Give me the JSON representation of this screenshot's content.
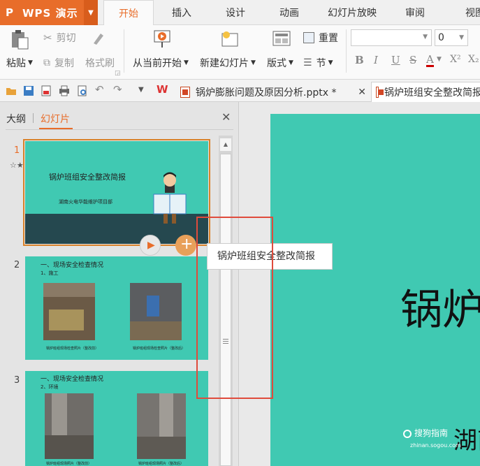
{
  "app": {
    "name": "WPS 演示",
    "logo": "P"
  },
  "menu": [
    {
      "label": "开始",
      "active": true
    },
    {
      "label": "插入"
    },
    {
      "label": "设计"
    },
    {
      "label": "动画"
    },
    {
      "label": "幻灯片放映"
    },
    {
      "label": "审阅"
    },
    {
      "label": "视图"
    }
  ],
  "ribbon": {
    "paste": "粘贴",
    "cut": "剪切",
    "copy": "复制",
    "format_painter": "格式刷",
    "from_current": "从当前开始",
    "new_slide": "新建幻灯片",
    "layout": "版式",
    "reset": "重置",
    "section": "节",
    "font_size": "0",
    "fmt_bold": "B",
    "fmt_italic": "I",
    "fmt_underline": "U",
    "fmt_strike": "S",
    "fmt_color": "A",
    "fmt_sup": "X²",
    "fmt_sub": "X₂"
  },
  "doc_tabs": [
    {
      "label": "锅炉膨胀问题及原因分析.pptx *",
      "active": false
    },
    {
      "label": "锅炉班组安全整改简报",
      "active": true
    }
  ],
  "panel": {
    "tab_outline": "大纲",
    "tab_slides": "幻灯片"
  },
  "slides": [
    {
      "num": "1",
      "title": "锅炉班组安全整改简报",
      "subtitle": "湖南火电华能维护项目部"
    },
    {
      "num": "2",
      "heading": "一、现场安全检查情况",
      "item": "1、施工",
      "cap1": "锅炉班组现场检查照片（整改前）",
      "cap2": "锅炉班组现场检查照片（整改后）"
    },
    {
      "num": "3",
      "heading": "一、现场安全检查情况",
      "item": "2、环境",
      "cap1": "锅炉班组现场照片（整改前）",
      "cap2": "锅炉班组现场照片（整改后）"
    }
  ],
  "tooltip": "锅炉班组安全整改简报",
  "main_slide": {
    "title": "锅炉",
    "subtitle": "湖南",
    "watermark": "搜狗指南",
    "watermark_url": "zhinan.sogou.com"
  },
  "colors": {
    "accent": "#e86d2a",
    "slide_bg": "#40c9b2",
    "highlight_rect": "#e04b3c"
  }
}
